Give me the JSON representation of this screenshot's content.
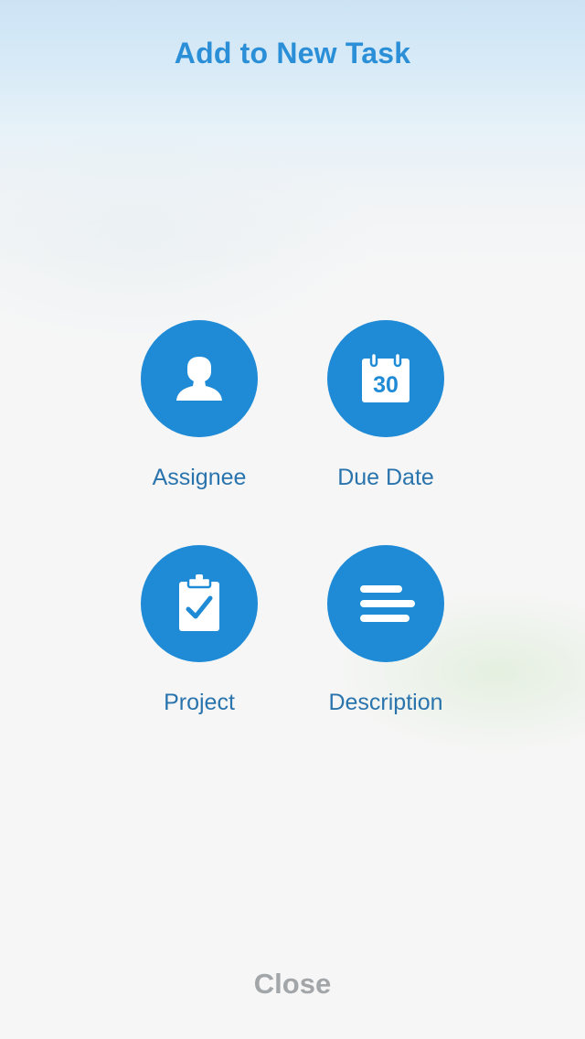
{
  "header": {
    "title": "Add to New Task"
  },
  "options": [
    {
      "id": "assignee",
      "label": "Assignee",
      "icon": "person-icon"
    },
    {
      "id": "due_date",
      "label": "Due Date",
      "icon": "calendar-icon",
      "icon_text": "30"
    },
    {
      "id": "project",
      "label": "Project",
      "icon": "clipboard-check-icon"
    },
    {
      "id": "description",
      "label": "Description",
      "icon": "text-lines-icon"
    }
  ],
  "footer": {
    "close_label": "Close"
  },
  "colors": {
    "accent": "#1f8ad6",
    "title": "#2b8fd8",
    "label": "#2a74ad",
    "close": "#a3a6a9"
  }
}
